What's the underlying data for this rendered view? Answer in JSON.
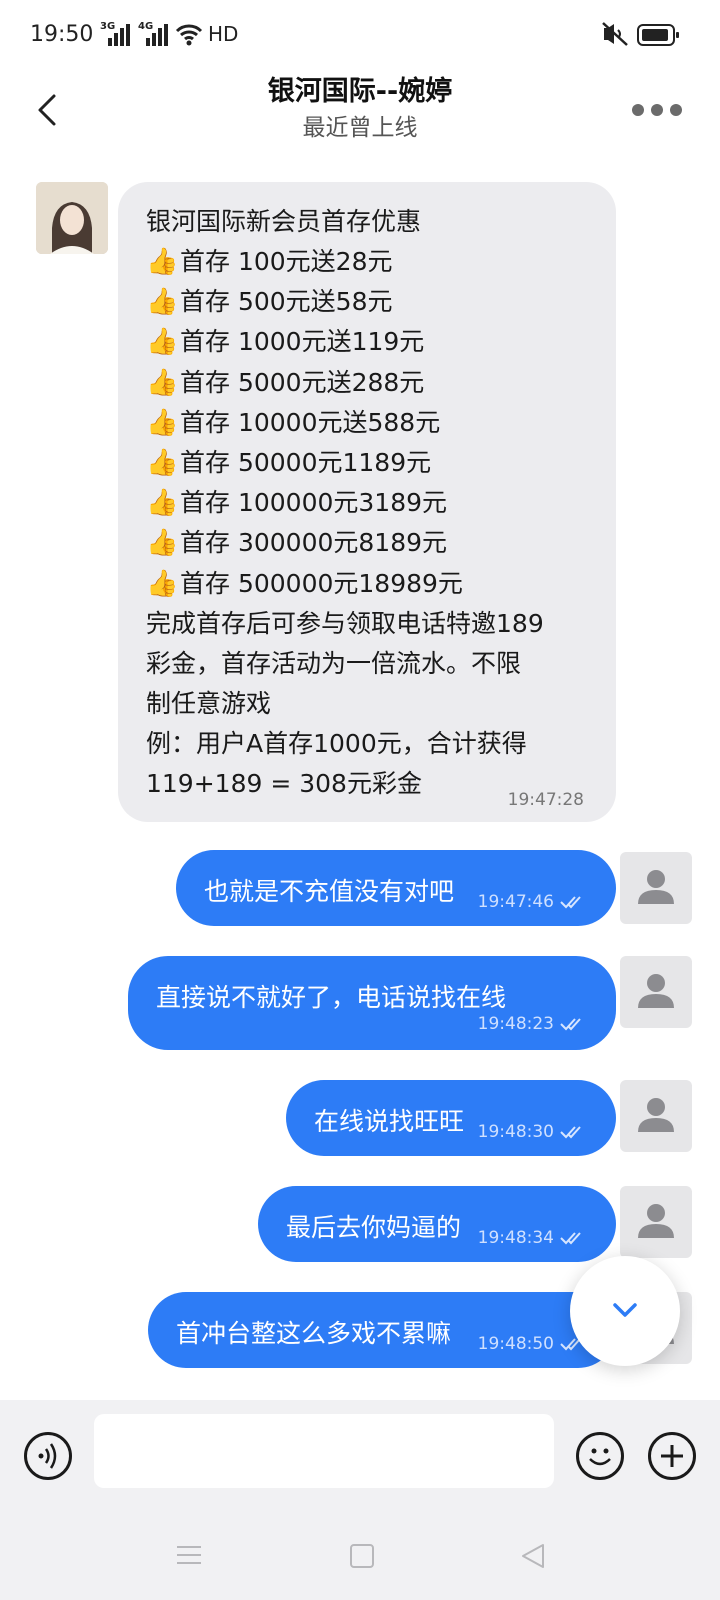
{
  "status_bar": {
    "time": "19:50",
    "network_1": "3G",
    "network_2": "4G",
    "hd": "HD"
  },
  "header": {
    "title": "银河国际--婉婷",
    "subtitle": "最近曾上线"
  },
  "incoming_message": {
    "heading": "银河国际新会员首存优惠",
    "offers": [
      "首存 100元送28元",
      "首存 500元送58元",
      "首存 1000元送119元",
      "首存 5000元送288元",
      "首存 10000元送588元",
      "首存 50000元1189元",
      "首存 100000元3189元",
      "首存 300000元8189元",
      "首存 500000元18989元"
    ],
    "note_lines": [
      "完成首存后可参与领取电话特邀189",
      "彩金，首存活动为一倍流水。不限",
      "制任意游戏",
      "例：用户A首存1000元，合计获得",
      "119+189 = 308元彩金"
    ],
    "time": "19:47:28"
  },
  "outgoing_messages": [
    {
      "text": "也就是不充值没有对吧",
      "time": "19:47:46"
    },
    {
      "text": "直接说不就好了，电话说找在线",
      "time": "19:48:23"
    },
    {
      "text": "在线说找旺旺",
      "time": "19:48:30"
    },
    {
      "text": "最后去你妈逼的",
      "time": "19:48:34"
    },
    {
      "text": "首冲台整这么多戏不累嘛",
      "time": "19:48:50"
    }
  ],
  "input": {
    "placeholder": ""
  },
  "icons": [
    "back-arrow-icon",
    "more-icon",
    "person-icon",
    "double-check-icon",
    "chevron-down-icon",
    "voice-icon",
    "emoji-icon",
    "plus-icon"
  ],
  "colors": {
    "outgoing_bubble": "#2d7cf6",
    "incoming_bubble": "#ececef",
    "input_bar": "#f1f1f3"
  }
}
